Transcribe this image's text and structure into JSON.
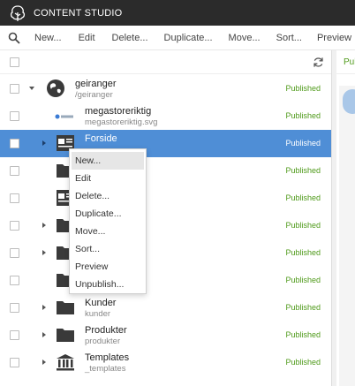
{
  "app": {
    "title": "CONTENT STUDIO"
  },
  "toolbar": {
    "search_icon": "search-icon",
    "buttons": [
      "New...",
      "Edit",
      "Delete...",
      "Duplicate...",
      "Move...",
      "Sort...",
      "Preview"
    ]
  },
  "rows": [
    {
      "name": "geiranger",
      "path": "/geiranger",
      "status": "Published",
      "icon": "globe-icon",
      "expander": "expanded"
    },
    {
      "name": "megastoreriktig",
      "path": "megastoreriktig.svg",
      "status": "Published",
      "icon": "image-icon"
    },
    {
      "name": "Forside",
      "path": "",
      "status": "Published",
      "icon": "page-icon",
      "expander": "collapsed",
      "selected": true
    },
    {
      "name": "",
      "path": "",
      "status": "Published",
      "icon": "folder-icon"
    },
    {
      "name": "",
      "path": "",
      "status": "Published",
      "icon": "page-icon"
    },
    {
      "name": "",
      "path": "",
      "status": "Published",
      "icon": "folder-icon",
      "expander": "collapsed"
    },
    {
      "name": "",
      "path": "",
      "status": "Published",
      "icon": "folder-icon",
      "expander": "collapsed"
    },
    {
      "name": "",
      "path": "",
      "status": "Published",
      "icon": "folder-icon"
    },
    {
      "name": "Kunder",
      "path": "kunder",
      "status": "Published",
      "icon": "folder-icon",
      "expander": "collapsed"
    },
    {
      "name": "Produkter",
      "path": "produkter",
      "status": "Published",
      "icon": "folder-icon",
      "expander": "collapsed"
    },
    {
      "name": "Templates",
      "path": "_templates",
      "status": "Published",
      "icon": "templates-icon",
      "expander": "collapsed"
    }
  ],
  "context_menu": {
    "items": [
      "New...",
      "Edit",
      "Delete...",
      "Duplicate...",
      "Move...",
      "Sort...",
      "Preview",
      "Unpublish..."
    ]
  },
  "right_panel": {
    "status_fragment": "Pul"
  },
  "colors": {
    "selected_row": "#4f8ed6",
    "published": "#4f9a1a",
    "topbar": "#2b2b2b"
  }
}
